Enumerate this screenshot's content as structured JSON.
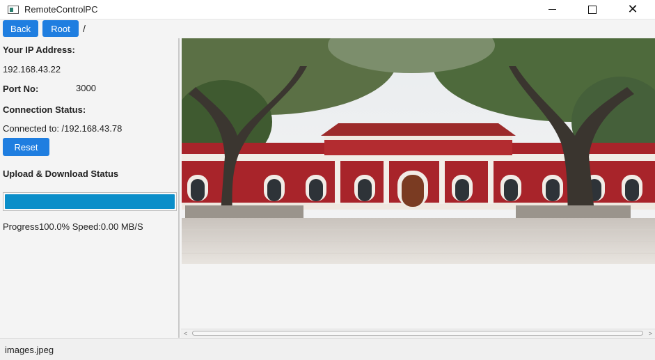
{
  "window": {
    "title": "RemoteControlPC",
    "icon": "app-window-icon",
    "controls": {
      "minimize": "minimize-icon",
      "maximize": "maximize-icon",
      "close": "✕"
    }
  },
  "toolbar": {
    "back_label": "Back",
    "root_label": "Root",
    "path": "/"
  },
  "info": {
    "ip_label": "Your IP Address:",
    "ip_value": "192.168.43.22",
    "port_label": "Port No:",
    "port_value": "3000",
    "conn_label": "Connection Status:",
    "conn_value": "Connected to: /192.168.43.78",
    "reset_label": "Reset",
    "transfer_label": "Upload & Download Status",
    "progress_fraction": 1.0,
    "progress_text": "Progress100.0% Speed:0.00 MB/S"
  },
  "colors": {
    "accent": "#1f7ee0",
    "progress": "#0b8ec9"
  },
  "viewer": {
    "image_icon": "building-photo",
    "scroll_left": "<",
    "scroll_right": ">"
  },
  "status": {
    "file_name": "images.jpeg"
  }
}
